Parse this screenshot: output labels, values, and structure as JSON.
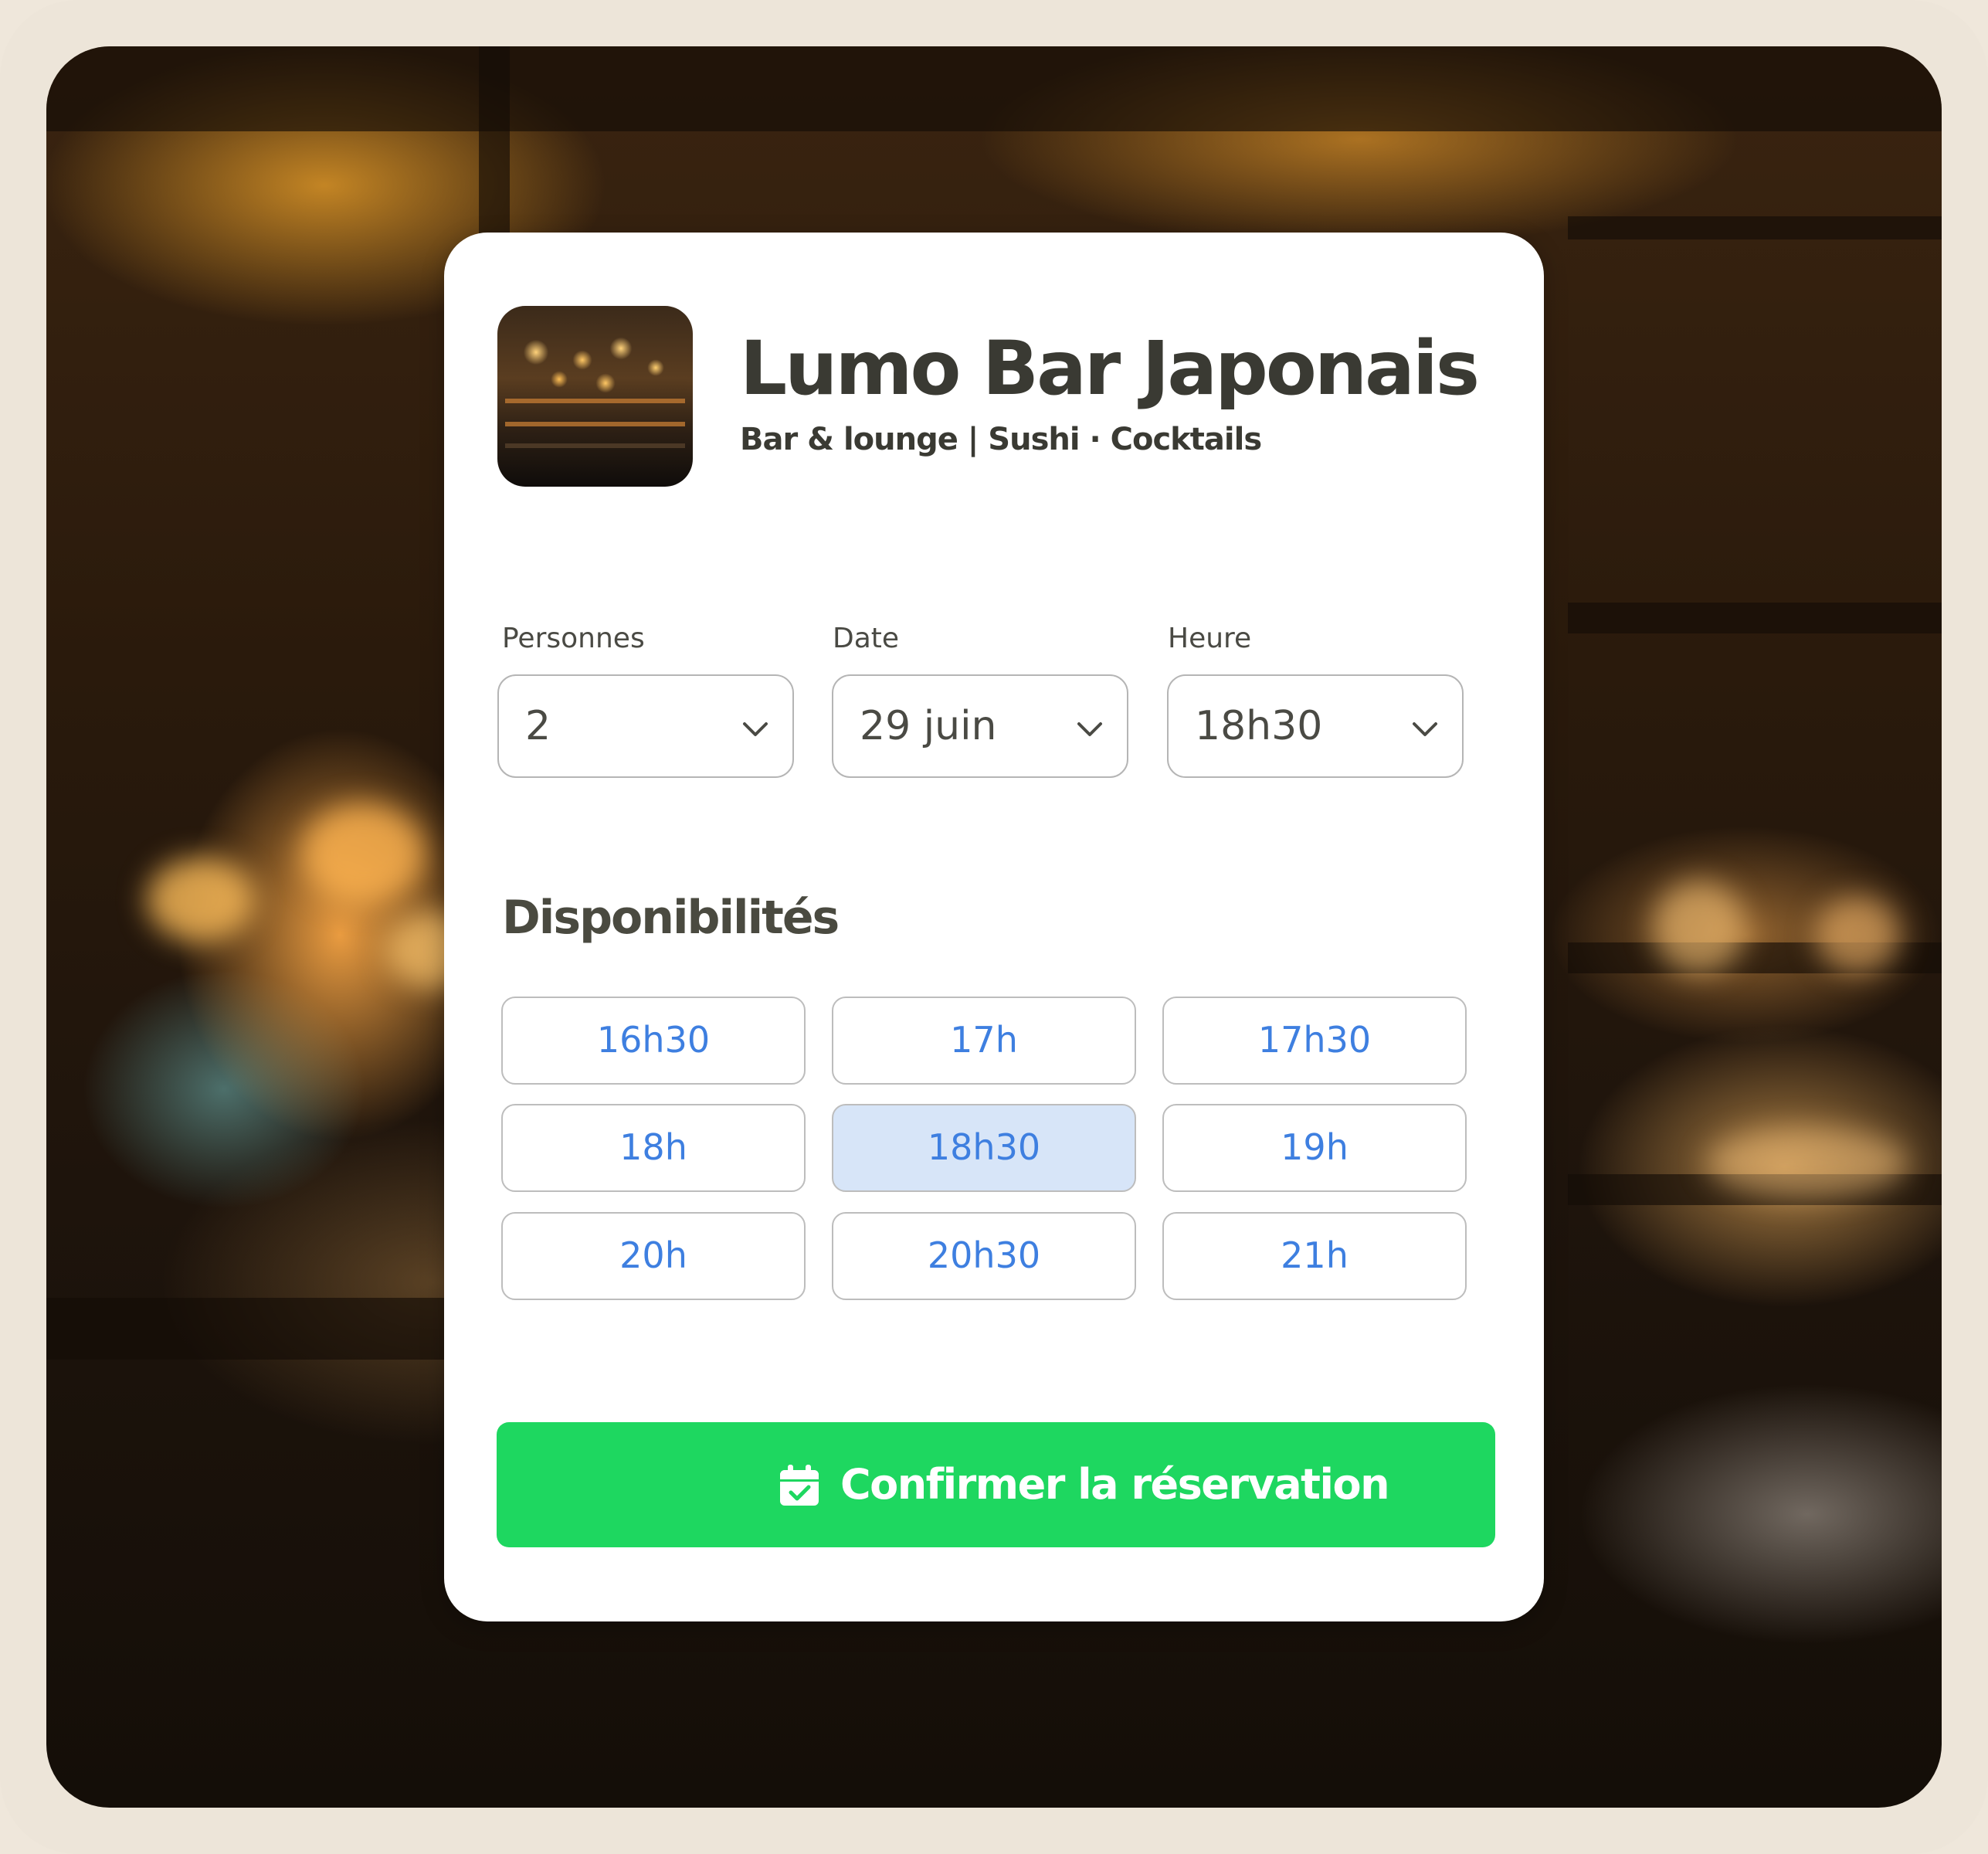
{
  "venue": {
    "name": "Lumo Bar Japonais",
    "tagline": "Bar & lounge | Sushi · Cocktails"
  },
  "fields": [
    {
      "label": "Personnes",
      "value": "2"
    },
    {
      "label": "Date",
      "value": "29 juin"
    },
    {
      "label": "Heure",
      "value": "18h30"
    }
  ],
  "availability": {
    "title": "Disponibilités",
    "slots": [
      "16h30",
      "17h",
      "17h30",
      "18h",
      "18h30",
      "19h",
      "20h",
      "20h30",
      "21h"
    ],
    "selected": "18h30"
  },
  "confirm": {
    "label": "Confirmer la réservation",
    "icon": "calendar-check-icon"
  },
  "colors": {
    "accent_green": "#1ED760",
    "slot_text_blue": "#3E7FE0",
    "slot_selected_bg": "#D7E5F8",
    "frame": "#EDE5D9"
  }
}
